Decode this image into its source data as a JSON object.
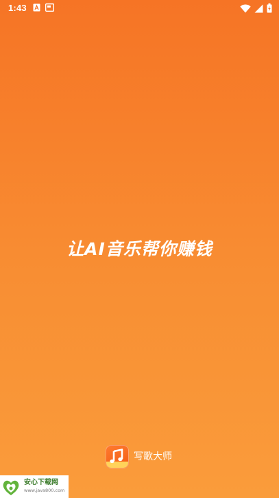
{
  "status_bar": {
    "time": "1:43",
    "left_icons": [
      "notification-a-icon",
      "notification-image-icon"
    ],
    "right_icons": [
      "wifi-icon",
      "signal-icon",
      "battery-icon"
    ]
  },
  "splash": {
    "slogan": "让AI音乐帮你赚钱"
  },
  "brand": {
    "logo_icon": "music-note-icon",
    "name": "写歌大师"
  },
  "watermark": {
    "title": "安心下载网",
    "url": "www.java800.com"
  },
  "colors": {
    "gradient_top": "#F67425",
    "gradient_bottom": "#FA9C3B",
    "text": "#FFFFFF",
    "logo_accent": "#FFD35A"
  }
}
